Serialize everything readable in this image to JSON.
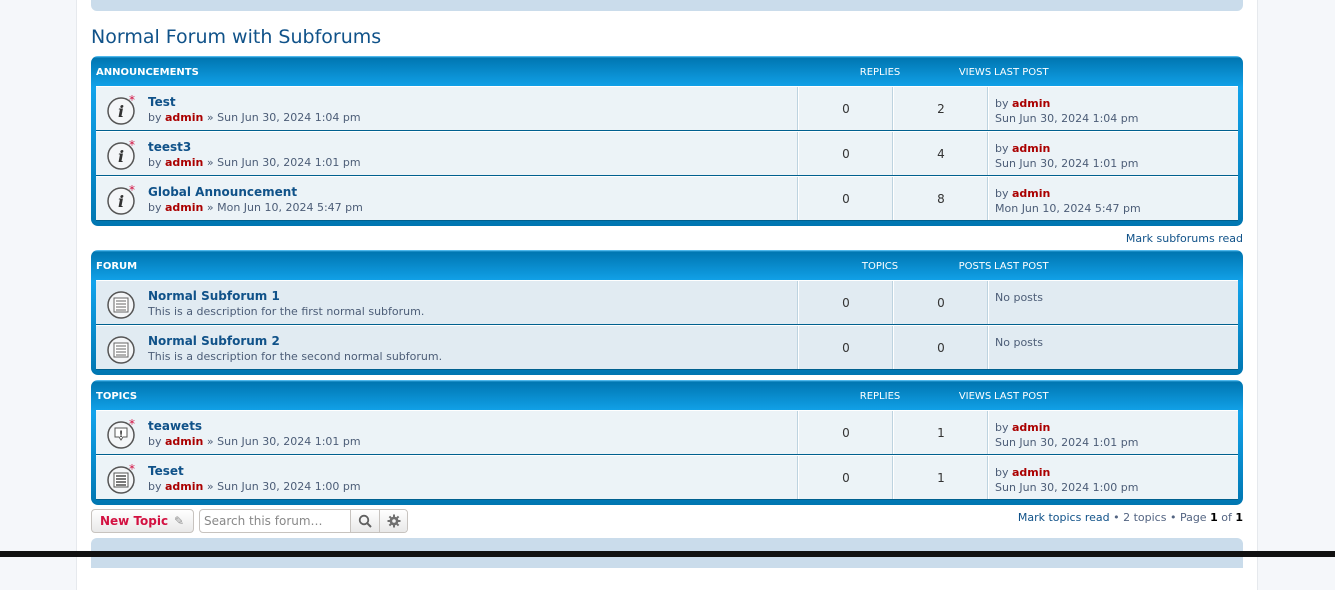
{
  "page_title": "Normal Forum with Subforums",
  "announcements": {
    "header": {
      "title": "ANNOUNCEMENTS",
      "col1": "REPLIES",
      "col2": "VIEWS",
      "col3": "LAST POST"
    },
    "rows": [
      {
        "title": "Test",
        "by": "by",
        "author": "admin",
        "sep": " » ",
        "date": "Sun Jun 30, 2024 1:04 pm",
        "replies": "0",
        "views": "2",
        "last_by": "by",
        "last_user": "admin",
        "last_date": "Sun Jun 30, 2024 1:04 pm"
      },
      {
        "title": "teest3",
        "by": "by",
        "author": "admin",
        "sep": " » ",
        "date": "Sun Jun 30, 2024 1:01 pm",
        "replies": "0",
        "views": "4",
        "last_by": "by",
        "last_user": "admin",
        "last_date": "Sun Jun 30, 2024 1:01 pm"
      },
      {
        "title": "Global Announcement",
        "by": "by",
        "author": "admin",
        "sep": " » ",
        "date": "Mon Jun 10, 2024 5:47 pm",
        "replies": "0",
        "views": "8",
        "last_by": "by",
        "last_user": "admin",
        "last_date": "Mon Jun 10, 2024 5:47 pm"
      }
    ]
  },
  "mark_subforums": "Mark subforums read",
  "forums": {
    "header": {
      "title": "FORUM",
      "col1": "TOPICS",
      "col2": "POSTS",
      "col3": "LAST POST"
    },
    "rows": [
      {
        "title": "Normal Subforum 1",
        "desc": "This is a description for the first normal subforum.",
        "topics": "0",
        "posts": "0",
        "last": "No posts"
      },
      {
        "title": "Normal Subforum 2",
        "desc": "This is a description for the second normal subforum.",
        "topics": "0",
        "posts": "0",
        "last": "No posts"
      }
    ]
  },
  "topics": {
    "header": {
      "title": "TOPICS",
      "col1": "REPLIES",
      "col2": "VIEWS",
      "col3": "LAST POST"
    },
    "rows": [
      {
        "title": "teawets",
        "by": "by",
        "author": "admin",
        "sep": " » ",
        "date": "Sun Jun 30, 2024 1:01 pm",
        "replies": "0",
        "views": "1",
        "last_by": "by",
        "last_user": "admin",
        "last_date": "Sun Jun 30, 2024 1:01 pm"
      },
      {
        "title": "Teset",
        "by": "by",
        "author": "admin",
        "sep": " » ",
        "date": "Sun Jun 30, 2024 1:00 pm",
        "replies": "0",
        "views": "1",
        "last_by": "by",
        "last_user": "admin",
        "last_date": "Sun Jun 30, 2024 1:00 pm"
      }
    ]
  },
  "action_bar": {
    "new_topic": "New Topic",
    "search_placeholder": "Search this forum…",
    "mark_topics": "Mark topics read",
    "bullet": " • ",
    "topic_count": "2 topics",
    "page_word": "Page",
    "page_current": "1",
    "of_word": "of",
    "page_total": "1"
  },
  "icons": {
    "announcement": "announcement-icon",
    "forum": "forum-read-icon",
    "poll": "poll-topic-icon",
    "topic": "topic-unread-icon",
    "pencil": "pencil-icon",
    "search": "search-icon",
    "gear": "gear-icon"
  },
  "colors": {
    "header_blue": "#0076b1",
    "link_blue": "#105289",
    "admin_red": "#aa0000",
    "new_topic_red": "#d31141"
  }
}
